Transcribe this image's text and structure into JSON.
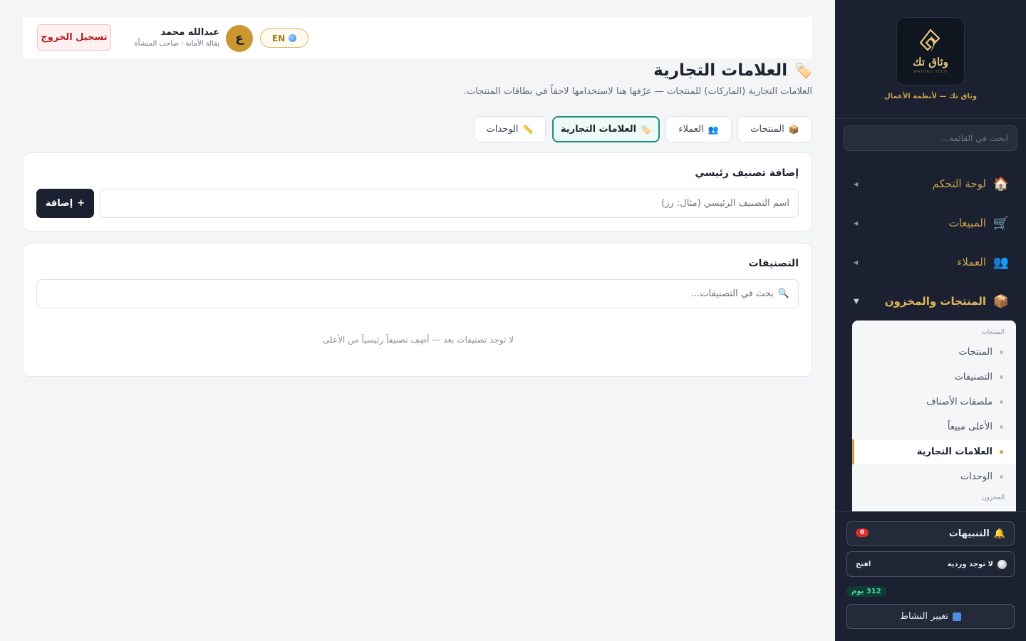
{
  "brand": {
    "logo_text": "وثاق تك",
    "logo_sub": "WATHAQ TECH",
    "tagline": "وثاق تك — لأنظمة الأعمال"
  },
  "sidebar": {
    "search_placeholder": "ابحث في القائمة...",
    "items": [
      {
        "label": "لوحة التحكم",
        "icon": "house-icon"
      },
      {
        "label": "المبيعات",
        "icon": "cart-icon"
      },
      {
        "label": "العملاء",
        "icon": "people-icon"
      },
      {
        "label": "المنتجات والمخزون",
        "icon": "box-icon"
      }
    ],
    "submenu": {
      "group1": "المنتجات",
      "items": [
        "المنتجات",
        "التصنيفات",
        "ملصقات الأصناف",
        "الأعلى مبيعاً",
        "العلامات التجارية",
        "الوحدات"
      ],
      "active_index": 4,
      "group2": "المخزون"
    },
    "alerts_label": "التنبيهات",
    "alerts_count": "6",
    "shift_label": "لا توجد وردية",
    "shift_open": "افتح",
    "days_label": "312 يوم",
    "switch_label": "تغيير النشاط"
  },
  "topbar": {
    "logout": "تسجيل الخروج",
    "user_name": "عبدالله محمد",
    "user_sub": "بقالة الأمانة · صاحب المنشأة",
    "avatar_letter": "ع",
    "lang": "EN"
  },
  "page": {
    "title": "العلامات التجارية",
    "subtitle": "العلامات التجارية (الماركات) للمنتجات — عرّفها هنا لاستخدامها لاحقاً في بطاقات المنتجات."
  },
  "tabs": [
    {
      "label": "المنتجات",
      "icon": "box-icon"
    },
    {
      "label": "العملاء",
      "icon": "people-icon"
    },
    {
      "label": "العلامات التجارية",
      "icon": "tag-icon"
    },
    {
      "label": "الوحدات",
      "icon": "ruler-icon"
    }
  ],
  "add_card": {
    "title": "إضافة تصنيف رئيسي",
    "placeholder": "اسم التصنيف الرئيسي (مثال: رز)",
    "button": "إضافة"
  },
  "list_card": {
    "title": "التصنيفات",
    "search_placeholder": "بحث في التصنيفات...",
    "empty": "لا توجد تصنيفات بعد — أضِف تصنيفاً رئيسياً من الأعلى"
  }
}
